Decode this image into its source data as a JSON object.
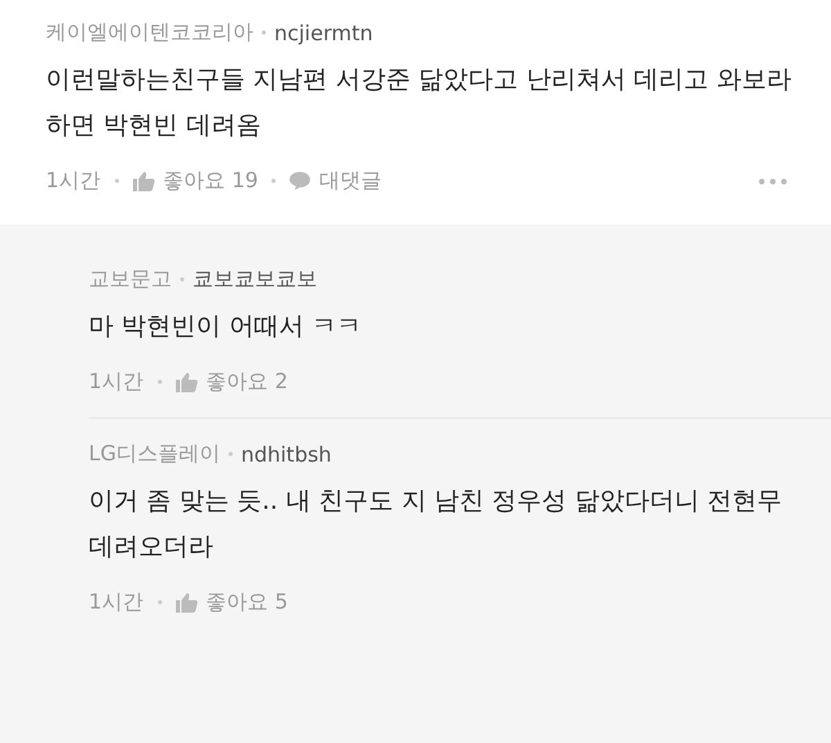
{
  "comments": [
    {
      "kind": "top",
      "org": "케이엘에이텐코코리아",
      "user": "ncjiermtn",
      "body": "이런말하는친구들 지남편 서강준 닮았다고 난리쳐서 데리고 와보라하면 박현빈 데려옴",
      "time": "1시간",
      "likes": "좋아요 19",
      "reply": "대댓글"
    },
    {
      "kind": "reply",
      "org": "교보문고",
      "user": "쿄보쿄보쿄보",
      "body": "마 박현빈이 어때서 ㅋㅋ",
      "time": "1시간",
      "likes": "좋아요 2"
    },
    {
      "kind": "reply",
      "org": "LG디스플레이",
      "user": "ndhitbsh",
      "body": "이거 좀 맞는 듯.. 내 친구도 지 남친 정우성 닮았다더니 전현무 데려오더라",
      "time": "1시간",
      "likes": "좋아요 5"
    }
  ]
}
